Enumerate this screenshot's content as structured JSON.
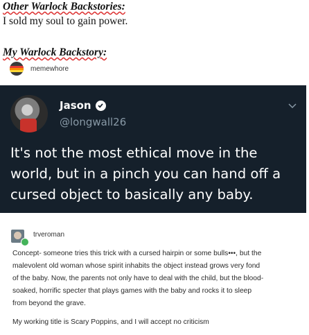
{
  "meme": {
    "heading1": "Other Warlock Backstories:",
    "line1": "I sold my soul to gain power.",
    "heading2": "My Warlock Backstory:"
  },
  "post": {
    "username": "memewhore"
  },
  "tweet": {
    "name": "Jason",
    "handle": "@longwall26",
    "text": "It's not the most ethical move in the world, but in a pinch you can hand off a cursed object to basically any baby."
  },
  "reply": {
    "username": "trveroman",
    "paragraph1": "Concept- someone tries this trick with a cursed hairpin or some bulls•••, but the\nmalevolent old woman whose spirit inhabits the object instead grows very fond\nof the baby. Now, the parents not only have to deal with the child, but the blood-\nsoaked, horrific specter that plays games with the baby and rocks it to sleep\nfrom beyond the grave.",
    "paragraph2": "My working title is Scary Poppins, and I will accept no criticism"
  },
  "colors": {
    "tweet_bg": "#15202b",
    "handle": "#8899a6",
    "spellcheck_underline": "#d33"
  }
}
